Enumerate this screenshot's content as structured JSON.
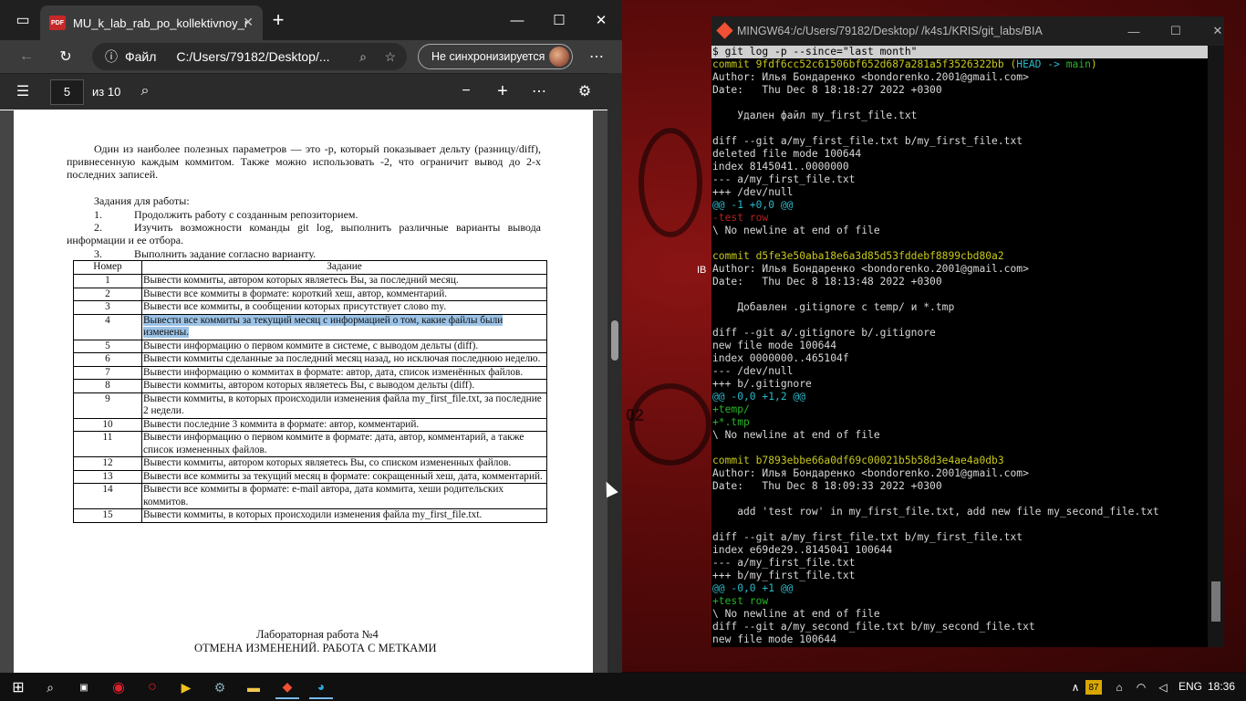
{
  "browser": {
    "tab_title": "MU_k_lab_rab_po_kollektivnoy_r",
    "pdf_badge": "PDF",
    "file_label": "Файл",
    "url": "C:/Users/79182/Desktop/...",
    "sync_label": "Не синхронизируется"
  },
  "pdf_toolbar": {
    "page_value": "5",
    "page_total": "из 10"
  },
  "document": {
    "intro": "Один из наиболее полезных параметров — это -p, который показывает дельту (разницу/diff), привнесенную каждым коммитом. Также можно использовать -2, что ограничит вывод до 2-х последних записей.",
    "tasks_heading": "Задания для работы:",
    "task1_num": "1.",
    "task1": "Продолжить работу с созданным репозиторием.",
    "task2_num": "2.",
    "task2": "Изучить возможности команды git log, выполнить различные варианты вывода информации и ее отбора.",
    "task3_num": "3.",
    "task3": "Выполнить задание согласно варианту.",
    "table_headers": [
      "Номер",
      "Задание"
    ],
    "rows": [
      {
        "n": "1",
        "t": "Вывести коммиты, автором которых являетесь Вы, за последний месяц."
      },
      {
        "n": "2",
        "t": "Вывести все коммиты в формате: короткий хеш, автор, комментарий."
      },
      {
        "n": "3",
        "t": "Вывести все коммиты, в сообщении которых присутствует слово my."
      },
      {
        "n": "4",
        "t": "Вывести все коммиты за текущий месяц с информацией о том, какие файлы были изменены."
      },
      {
        "n": "5",
        "t": "Вывести информацию о первом коммите в системе, с выводом дельты (diff)."
      },
      {
        "n": "6",
        "t": "Вывести коммиты сделанные за последний месяц назад, но исключая последнюю неделю."
      },
      {
        "n": "7",
        "t": "Вывести информацию о коммитах в формате: автор, дата, список изменённых файлов."
      },
      {
        "n": "8",
        "t": "Вывести коммиты, автором которых являетесь Вы, с выводом дельты (diff)."
      },
      {
        "n": "9",
        "t": "Вывести коммиты, в которых происходили изменения файла my_first_file.txt, за последние 2 недели."
      },
      {
        "n": "10",
        "t": "Вывести последние 3 коммита в формате: автор, комментарий."
      },
      {
        "n": "11",
        "t": "Вывести информацию о первом коммите в формате: дата, автор, комментарий, а также список измененных файлов."
      },
      {
        "n": "12",
        "t": "Вывести коммиты, автором которых являетесь Вы, со списком измененных файлов."
      },
      {
        "n": "13",
        "t": "Вывести все коммиты за текущий месяц в формате: сокращенный хеш, дата, комментарий."
      },
      {
        "n": "14",
        "t": "Вывести все коммиты в формате: e-mail автора, дата коммита, хеши родительских коммитов."
      },
      {
        "n": "15",
        "t": "Вывести коммиты, в которых происходили изменения файла my_first_file.txt."
      }
    ],
    "lab_title": "Лабораторная работа №4",
    "lab_subtitle": "ОТМЕНА ИЗМЕНЕНИЙ. РАБОТА С МЕТКАМИ"
  },
  "terminal": {
    "title": "MINGW64:/c/Users/79182/Desktop/  /k4s1/KRIS/git_labs/BIA",
    "lines": [
      {
        "t": "$ git log -p --since=\"last month\"",
        "c": "cmdline"
      },
      {
        "t": "commit 9fdf6cc52c61506bf652d687a281a5f3526322bb ",
        "c": "c-yel",
        "extra": [
          {
            "t": "(",
            "c": "c-yel"
          },
          {
            "t": "HEAD -> ",
            "c": "c-head"
          },
          {
            "t": "main",
            "c": "c-main"
          },
          {
            "t": ")",
            "c": "c-yel"
          }
        ]
      },
      {
        "t": "Author: Илья Бондаренко <bondorenko.2001@gmail.com>"
      },
      {
        "t": "Date:   Thu Dec 8 18:18:27 2022 +0300"
      },
      {
        "t": ""
      },
      {
        "t": "    Удален файл my_first_file.txt"
      },
      {
        "t": ""
      },
      {
        "t": "diff --git a/my_first_file.txt b/my_first_file.txt"
      },
      {
        "t": "deleted file mode 100644"
      },
      {
        "t": "index 8145041..0000000"
      },
      {
        "t": "--- a/my_first_file.txt"
      },
      {
        "t": "+++ /dev/null"
      },
      {
        "t": "@@ -1 +0,0 @@",
        "c": "c-cyan"
      },
      {
        "t": "-test row",
        "c": "c-red"
      },
      {
        "t": "\\ No newline at end of file"
      },
      {
        "t": ""
      },
      {
        "t": "commit d5fe3e50aba18e6a3d85d53fddebf8899cbd80a2",
        "c": "c-yel"
      },
      {
        "t": "Author: Илья Бондаренко <bondorenko.2001@gmail.com>"
      },
      {
        "t": "Date:   Thu Dec 8 18:13:48 2022 +0300"
      },
      {
        "t": ""
      },
      {
        "t": "    Добавлен .gitignore с temp/ и *.tmp"
      },
      {
        "t": ""
      },
      {
        "t": "diff --git a/.gitignore b/.gitignore"
      },
      {
        "t": "new file mode 100644"
      },
      {
        "t": "index 0000000..465104f"
      },
      {
        "t": "--- /dev/null"
      },
      {
        "t": "+++ b/.gitignore"
      },
      {
        "t": "@@ -0,0 +1,2 @@",
        "c": "c-cyan"
      },
      {
        "t": "+temp/",
        "c": "c-grn"
      },
      {
        "t": "+*.tmp",
        "c": "c-grn"
      },
      {
        "t": "\\ No newline at end of file"
      },
      {
        "t": ""
      },
      {
        "t": "commit b7893ebbe66a0df69c00021b5b58d3e4ae4a0db3",
        "c": "c-yel"
      },
      {
        "t": "Author: Илья Бондаренко <bondorenko.2001@gmail.com>"
      },
      {
        "t": "Date:   Thu Dec 8 18:09:33 2022 +0300"
      },
      {
        "t": ""
      },
      {
        "t": "    add 'test row' in my_first_file.txt, add new file my_second_file.txt"
      },
      {
        "t": ""
      },
      {
        "t": "diff --git a/my_first_file.txt b/my_first_file.txt"
      },
      {
        "t": "index e69de29..8145041 100644"
      },
      {
        "t": "--- a/my_first_file.txt"
      },
      {
        "t": "+++ b/my_first_file.txt"
      },
      {
        "t": "@@ -0,0 +1 @@",
        "c": "c-cyan"
      },
      {
        "t": "+test row",
        "c": "c-grn"
      },
      {
        "t": "\\ No newline at end of file"
      },
      {
        "t": "diff --git a/my_second_file.txt b/my_second_file.txt"
      },
      {
        "t": "new file mode 100644"
      }
    ]
  },
  "taskbar": {
    "lang": "ENG",
    "time": "18:36",
    "badge": "87"
  },
  "desktop": {
    "wallpaper_text": "02",
    "icon_label": "IB"
  }
}
